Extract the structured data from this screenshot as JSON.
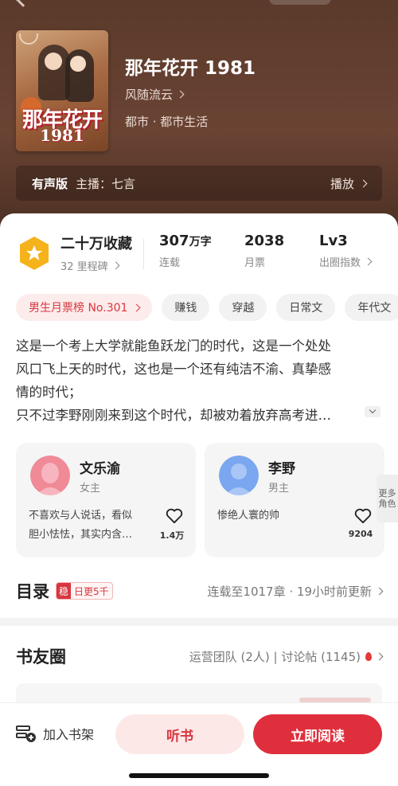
{
  "book": {
    "title": "那年花开 1981",
    "author": "风随流云",
    "genre": "都市 · 都市生活",
    "cover": {
      "title": "那年花开",
      "year": "1981"
    }
  },
  "audio": {
    "label": "有声版",
    "host": "主播：七言",
    "play_label": "播放"
  },
  "stats": {
    "collect": {
      "value": "二十万收藏",
      "sub": "32 里程碑"
    },
    "words": {
      "value": "307",
      "unit": "万字",
      "sub": "连载"
    },
    "monthly": {
      "value": "2038",
      "sub": "月票"
    },
    "level": {
      "value": "Lv3",
      "sub": "出圈指数"
    }
  },
  "tags": [
    "男生月票榜 No.301",
    "赚钱",
    "穿越",
    "日常文",
    "年代文"
  ],
  "synopsis": [
    "这是一个考上大学就能鱼跃龙门的时代，这是一个处处",
    "风口飞上天的时代，这也是一个还有纯洁不渝、真挚感",
    "情的时代；",
    "只不过李野刚刚来到这个时代，却被劝着放弃高考进…"
  ],
  "roles": [
    {
      "name": "文乐渝",
      "role": "女主",
      "desc1": "不喜欢与人说话，看似",
      "desc2": "胆小怯怯，其实内含…",
      "likes": "1.4万"
    },
    {
      "name": "李野",
      "role": "男主",
      "desc1": "惨绝人寰的帅",
      "desc2": "",
      "likes": "9204"
    }
  ],
  "more_roles": "更多角色",
  "toc": {
    "heading": "目录",
    "badge_icon": "稳",
    "badge_text": "日更5千",
    "info": "连载至1017章 · 19小时前更新"
  },
  "circle": {
    "heading": "书友圈",
    "info": "运营团队 (2人) | 讨论帖 (1145)"
  },
  "bottom": {
    "shelf": "加入书架",
    "listen": "听书",
    "read": "立即阅读"
  },
  "colors": {
    "accent": "#df2f3c",
    "hero_bg": "#5b3a2b",
    "female_avatar": "#f08a97",
    "male_avatar": "#7aa7ef"
  },
  "icons": [
    "back-arrow-icon",
    "star-medal-icon",
    "chevron-right-icon",
    "heart-icon",
    "flame-icon",
    "bookshelf-add-icon"
  ]
}
